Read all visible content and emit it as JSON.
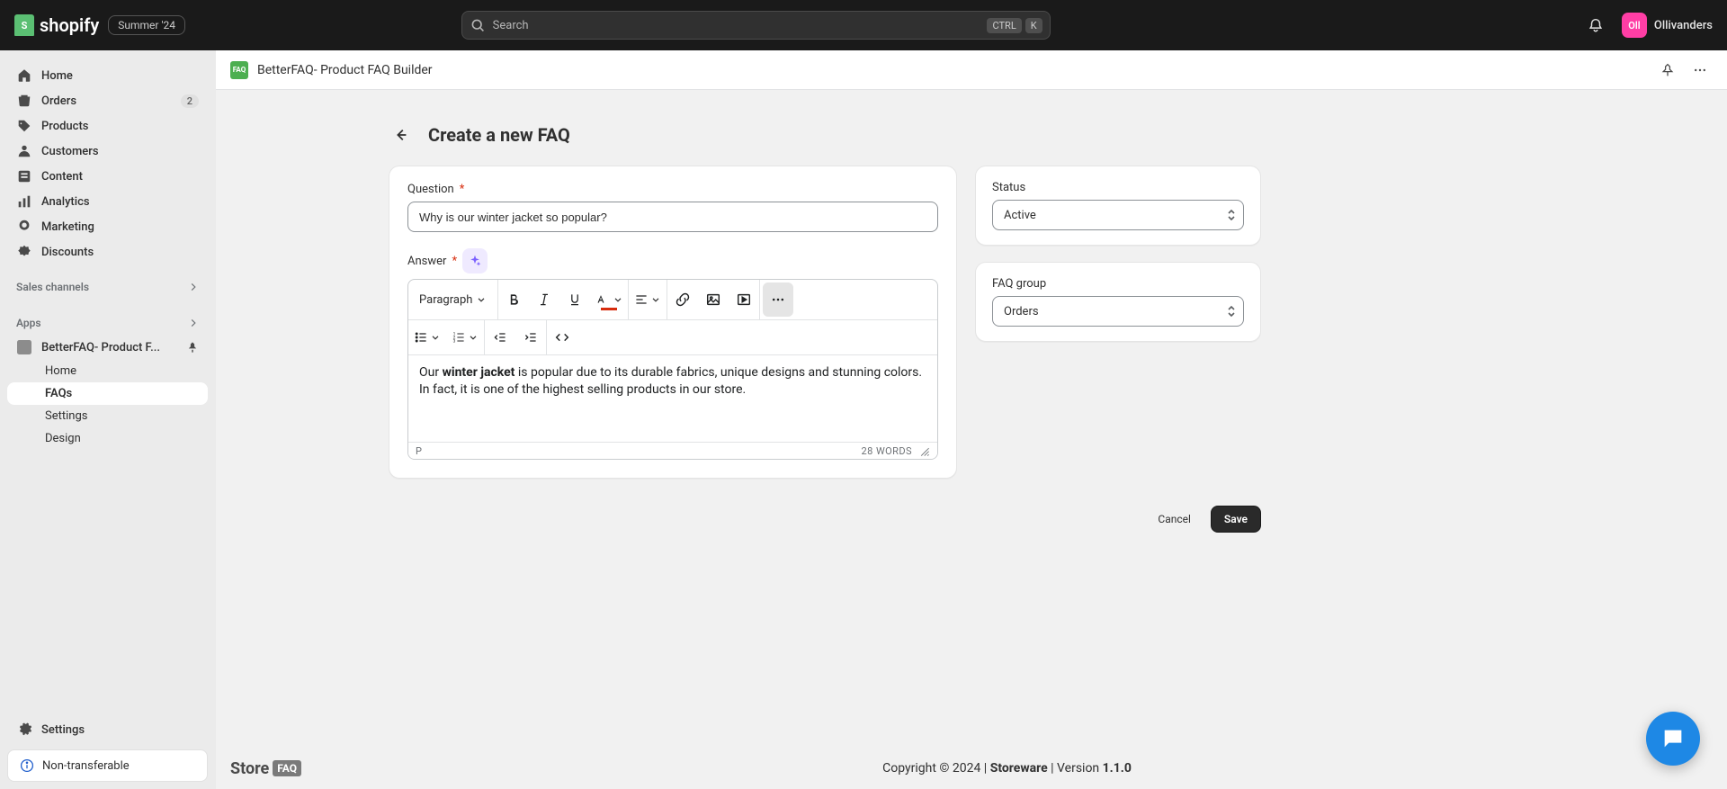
{
  "header": {
    "brand": "shopify",
    "edition_badge": "Summer '24",
    "search_placeholder": "Search",
    "kbd1": "CTRL",
    "kbd2": "K",
    "user_initials": "Oll",
    "user_name": "Ollivanders"
  },
  "sidebar": {
    "items": [
      {
        "label": "Home"
      },
      {
        "label": "Orders",
        "badge": "2"
      },
      {
        "label": "Products"
      },
      {
        "label": "Customers"
      },
      {
        "label": "Content"
      },
      {
        "label": "Analytics"
      },
      {
        "label": "Marketing"
      },
      {
        "label": "Discounts"
      }
    ],
    "sales_section": "Sales channels",
    "apps_section": "Apps",
    "app_item": "BetterFAQ- Product F...",
    "app_sub": [
      {
        "label": "Home"
      },
      {
        "label": "FAQs"
      },
      {
        "label": "Settings"
      },
      {
        "label": "Design"
      }
    ],
    "settings": "Settings",
    "non_transferable": "Non-transferable"
  },
  "app_header": {
    "title": "BetterFAQ- Product FAQ Builder"
  },
  "page": {
    "title": "Create a new FAQ",
    "question_label": "Question",
    "question_value": "Why is our winter jacket so popular?",
    "answer_label": "Answer",
    "paragraph_label": "Paragraph",
    "answer_pre": "Our ",
    "answer_bold": "winter jacket",
    "answer_post": " is popular due to its durable fabrics, unique designs and stunning colors. In fact, it is one of the highest selling products in our store.",
    "path_indicator": "P",
    "word_count": "28 WORDS",
    "cancel": "Cancel",
    "save": "Save"
  },
  "side": {
    "status_label": "Status",
    "status_value": "Active",
    "group_label": "FAQ group",
    "group_value": "Orders"
  },
  "footer": {
    "logo_store": "Store",
    "logo_faq": "FAQ",
    "copyright_pre": "Copyright © 2024 | ",
    "company": "Storeware",
    "version_label": " | Version ",
    "version": "1.1.0"
  }
}
